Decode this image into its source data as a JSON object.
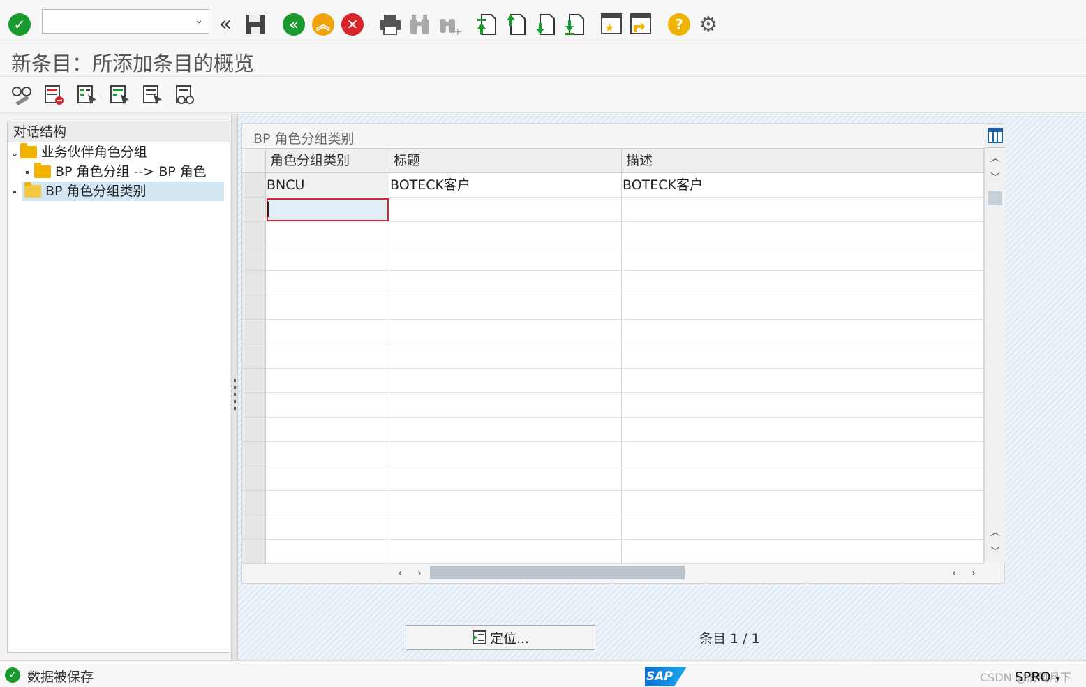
{
  "page_title": "新条目：所添加条目的概览",
  "command_field": {
    "value": ""
  },
  "left_panel": {
    "header": "对话结构",
    "tree": [
      {
        "label": "业务伙伴角色分组"
      },
      {
        "label": "BP 角色分组 --> BP 角色"
      },
      {
        "label": "BP 角色分组类别"
      }
    ]
  },
  "table_group": {
    "title": "BP 角色分组类别",
    "columns": [
      "角色分组类别",
      "标题",
      "描述"
    ],
    "rows": [
      [
        "BNCU",
        "BOTECK客户",
        "BOTECK客户"
      ],
      [
        "",
        "",
        ""
      ],
      [
        "",
        "",
        ""
      ],
      [
        "",
        "",
        ""
      ],
      [
        "",
        "",
        ""
      ],
      [
        "",
        "",
        ""
      ],
      [
        "",
        "",
        ""
      ],
      [
        "",
        "",
        ""
      ],
      [
        "",
        "",
        ""
      ],
      [
        "",
        "",
        ""
      ],
      [
        "",
        "",
        ""
      ],
      [
        "",
        "",
        ""
      ],
      [
        "",
        "",
        ""
      ],
      [
        "",
        "",
        ""
      ],
      [
        "",
        "",
        ""
      ],
      [
        "",
        "",
        ""
      ]
    ]
  },
  "position_button": "定位...",
  "entry_count": "条目 1 / 1",
  "status": {
    "message": "数据被保存"
  },
  "system": {
    "logo": "SAP",
    "transaction": "SPRO",
    "watermark": "CSDN @清风月下"
  },
  "colors": {
    "green": "#1a9a2e",
    "orange": "#f0a30a",
    "red": "#d9262c",
    "help": "#f0b400",
    "selection": "#d3e6f3"
  },
  "icons": {
    "toolbar": [
      "enter-check-icon",
      "back-double-chevron-icon",
      "save-icon",
      "back-icon",
      "exit-icon",
      "cancel-icon",
      "print-icon",
      "find-icon",
      "find-next-icon",
      "first-page-icon",
      "previous-page-icon",
      "next-page-icon",
      "last-page-icon",
      "new-session-icon",
      "shortcut-icon",
      "help-icon",
      "settings-gear-icon"
    ]
  }
}
